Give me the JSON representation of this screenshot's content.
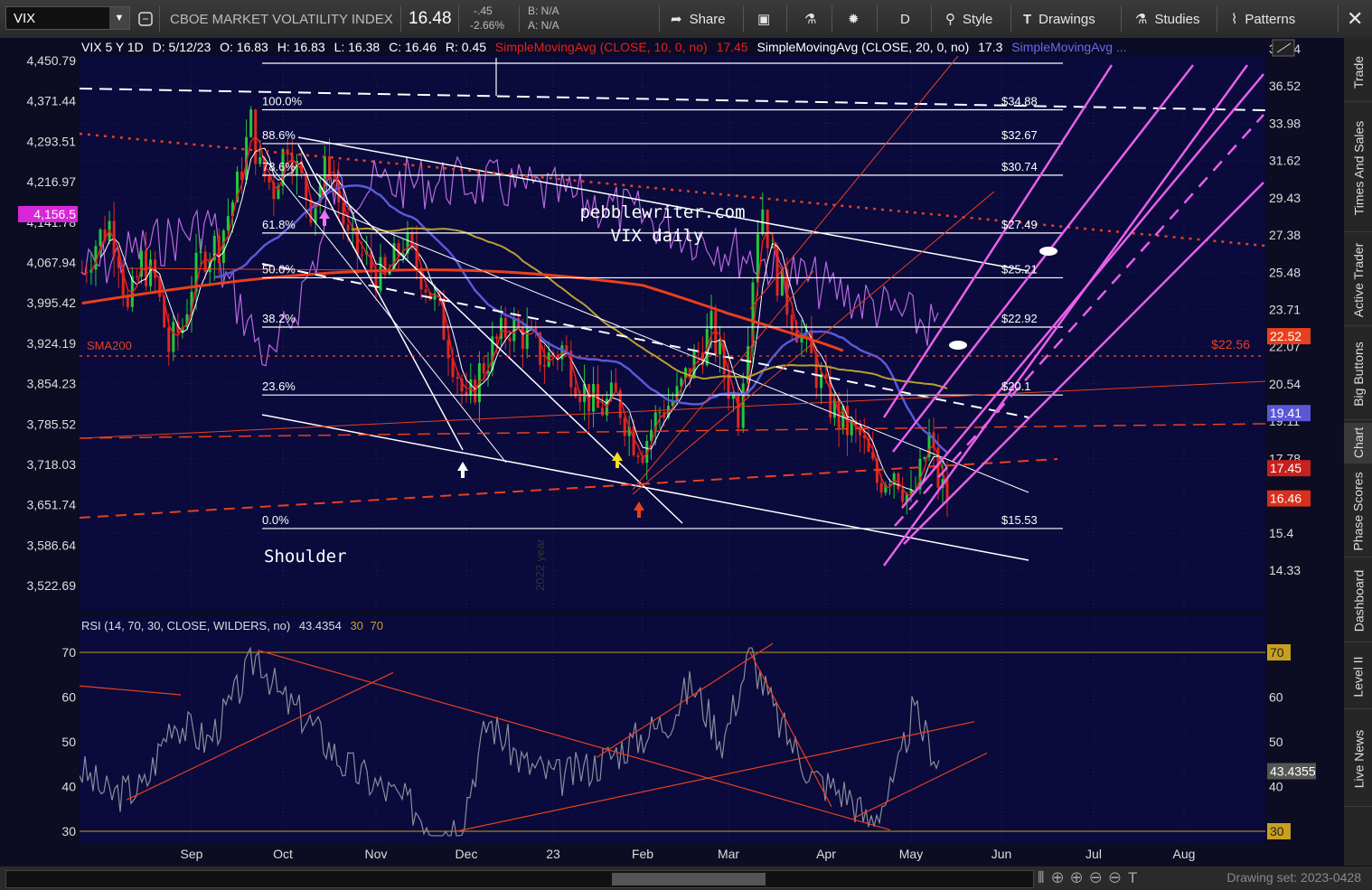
{
  "toolbar": {
    "symbol": "VIX",
    "name": "CBOE MARKET VOLATILITY INDEX",
    "last": "16.48",
    "change": "-.45",
    "change_pct": "-2.66%",
    "bid": "B: N/A",
    "ask": "A: N/A",
    "share": "Share",
    "period": "D",
    "style": "Style",
    "drawings": "Drawings",
    "studies": "Studies",
    "patterns": "Patterns"
  },
  "header": {
    "title": "VIX 5 Y 1D",
    "date": "D: 5/12/23",
    "open": "O: 16.83",
    "high": "H: 16.83",
    "low": "L: 16.38",
    "close": "C: 16.46",
    "range": "R: 0.45",
    "sma10": "SimpleMovingAvg (CLOSE, 10, 0, no)",
    "sma10_val": "17.45",
    "sma20": "SimpleMovingAvg (CLOSE, 20, 0, no)",
    "sma20_val": "17.3",
    "sma3": "SimpleMovingAvg ..."
  },
  "rsi_header": {
    "label": "RSI (14, 70, 30, CLOSE, WILDERS, no)",
    "value": "43.4354",
    "ob": "30",
    "os": "70"
  },
  "right_tabs": [
    "Trade",
    "Times And Sales",
    "Active Trader",
    "Big Buttons",
    "Chart",
    "Phase Scores",
    "Dashboard",
    "Level II",
    "Live News"
  ],
  "bottom": {
    "drawing_set": "Drawing set: 2023-0428"
  },
  "annotations": {
    "watermark_1": "pebblewriter.com",
    "watermark_2": "VIX daily",
    "shoulder": "Shoulder",
    "sma200": "SMA200",
    "year": "2022 year",
    "price_2256": "$22.56"
  },
  "chart_data": {
    "type": "candlestick",
    "x_months": [
      "Sep",
      "Oct",
      "Nov",
      "Dec",
      "23",
      "Feb",
      "Mar",
      "Apr",
      "May",
      "Jun",
      "Jul",
      "Aug"
    ],
    "left_axis_ticks": [
      "4,450.79",
      "4,371.44",
      "4,293.51",
      "4,216.97",
      "4,141.78",
      "4,067.94",
      "3,995.42",
      "3,924.19",
      "3,854.23",
      "3,785.52",
      "3,718.03",
      "3,651.74",
      "3,586.64",
      "3,522.69"
    ],
    "left_axis_highlight": "4,156.5",
    "right_axis_ticks": [
      "39.24",
      "36.52",
      "33.98",
      "31.62",
      "29.43",
      "27.38",
      "25.48",
      "23.71",
      "22.07",
      "20.54",
      "19.11",
      "17.78",
      "15.4",
      "14.33"
    ],
    "right_axis_labels": [
      {
        "text": "22.52",
        "value": 22.52,
        "color": "#e8401c"
      },
      {
        "text": "19.41",
        "value": 19.41,
        "color": "#5a58d8"
      },
      {
        "text": "17.45",
        "value": 17.45,
        "color": "#c8201c"
      },
      {
        "text": "16.46",
        "value": 16.46,
        "color": "#d8301c"
      }
    ],
    "fib_levels": [
      {
        "pct": "100.0%",
        "price": "$34.88",
        "value": 34.88
      },
      {
        "pct": "88.6%",
        "price": "$32.67",
        "value": 32.67
      },
      {
        "pct": "78.6%",
        "price": "$30.74",
        "value": 30.74
      },
      {
        "pct": "61.8%",
        "price": "$27.49",
        "value": 27.49
      },
      {
        "pct": "50.0%",
        "price": "$25.21",
        "value": 25.21
      },
      {
        "pct": "38.2%",
        "price": "$22.92",
        "value": 22.92
      },
      {
        "pct": "23.6%",
        "price": "$20.1",
        "value": 20.1
      },
      {
        "pct": "0.0%",
        "price": "$15.53",
        "value": 15.53
      }
    ],
    "rsi_ticks": [
      "70",
      "60",
      "50",
      "40",
      "30"
    ],
    "rsi_right_labels": [
      {
        "text": "70",
        "color": "#c8a020"
      },
      {
        "text": "60",
        "color": ""
      },
      {
        "text": "50",
        "color": ""
      },
      {
        "text": "43.4355",
        "color": "#555"
      },
      {
        "text": "40",
        "color": ""
      },
      {
        "text": "30",
        "color": "#c8a020"
      }
    ]
  }
}
